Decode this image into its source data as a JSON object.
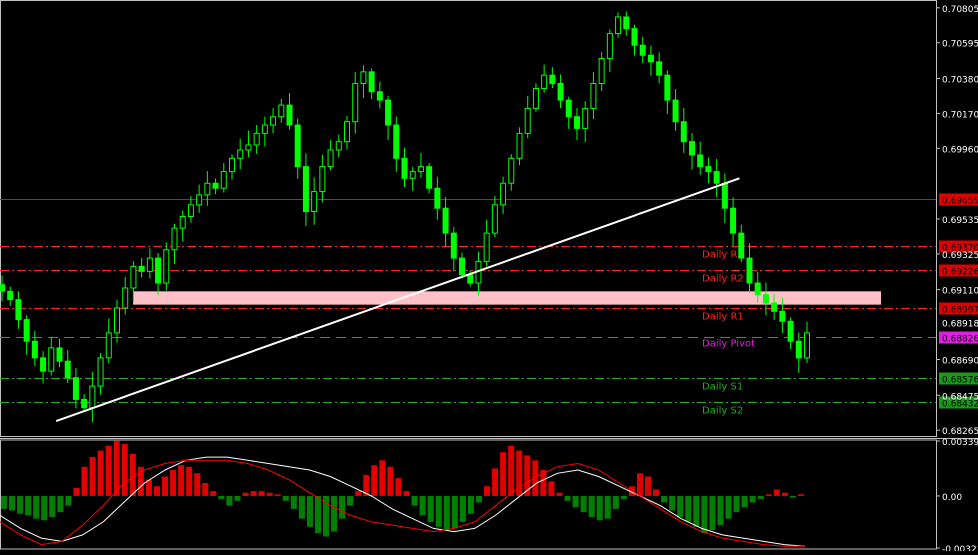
{
  "colors": {
    "background": "#000000",
    "frame": "#c0c0c0",
    "bull_candle": "#00ff00",
    "bear_candle": "#00ff00",
    "resistance": "#ff2020",
    "pivot": "#e020e0",
    "support": "#20b020",
    "horizontal_level": "#ff0000",
    "zone": "#ffc0c8",
    "trendline": "#ffffff",
    "hist_pos": "#e00000",
    "hist_neg": "#008000",
    "signal_white": "#ffffff",
    "signal_red": "#ff0000",
    "axis_text": "#ffffff"
  },
  "chart_data": [
    {
      "type": "candlestick",
      "panel": "price",
      "y_axis_ticks": [
        "0.70805",
        "0.70595",
        "0.70380",
        "0.70170",
        "0.69960",
        "0.69535",
        "0.69325",
        "0.69110",
        "0.68690",
        "0.68475",
        "0.68265"
      ],
      "ylim": [
        0.6823,
        0.7084
      ],
      "close_path": [
        0.691,
        0.6905,
        0.6893,
        0.688,
        0.687,
        0.6862,
        0.6876,
        0.6868,
        0.6858,
        0.6845,
        0.684,
        0.6853,
        0.687,
        0.6885,
        0.69,
        0.6912,
        0.6925,
        0.6922,
        0.693,
        0.6915,
        0.6935,
        0.6948,
        0.6955,
        0.6962,
        0.6968,
        0.6975,
        0.6972,
        0.6982,
        0.699,
        0.6995,
        0.6998,
        0.7005,
        0.701,
        0.7015,
        0.7022,
        0.701,
        0.6985,
        0.6958,
        0.697,
        0.6985,
        0.6995,
        0.7,
        0.7012,
        0.7035,
        0.7042,
        0.703,
        0.7025,
        0.701,
        0.699,
        0.6978,
        0.6982,
        0.6985,
        0.6972,
        0.696,
        0.6945,
        0.693,
        0.692,
        0.6915,
        0.6928,
        0.6945,
        0.6962,
        0.6975,
        0.699,
        0.7005,
        0.702,
        0.7032,
        0.704,
        0.7035,
        0.7025,
        0.7015,
        0.7008,
        0.702,
        0.7035,
        0.705,
        0.7065,
        0.7075,
        0.7068,
        0.7058,
        0.7052,
        0.7048,
        0.704,
        0.7025,
        0.7012,
        0.7,
        0.6992,
        0.6985,
        0.6982,
        0.6975,
        0.696,
        0.6945,
        0.693,
        0.6915,
        0.6908,
        0.6903,
        0.6898,
        0.6892,
        0.688,
        0.687,
        0.6885
      ],
      "levels": [
        {
          "label": "0.69655",
          "value": 0.69655,
          "style": "solid",
          "text": ""
        },
        {
          "label": "0.69370",
          "value": 0.6937,
          "style": "dashdot",
          "text": "Daily R3"
        },
        {
          "label": "0.69226",
          "value": 0.69226,
          "style": "dashdot",
          "text": "Daily R2"
        },
        {
          "label": "0.68997",
          "value": 0.68997,
          "style": "dashdot",
          "text": "Daily R1"
        },
        {
          "label": "0.68826",
          "value": 0.68826,
          "style": "dashed",
          "text": "Daily Pivot"
        },
        {
          "label": "0.68576",
          "value": 0.68576,
          "style": "dashdot",
          "text": "Daily S1"
        },
        {
          "label": "0.68432",
          "value": 0.68432,
          "style": "dashdot",
          "text": "Daily S2"
        }
      ],
      "current_price_label": "0.68918",
      "current_price": 0.68918,
      "zone": {
        "low": 0.6902,
        "high": 0.691
      },
      "trendline": {
        "from": [
          0.06,
          0.6832
        ],
        "to": [
          0.79,
          0.6978
        ]
      }
    },
    {
      "type": "histogram",
      "panel": "oscillator",
      "y_axis_ticks": [
        "0.00339",
        "0.00",
        "-0.00321"
      ],
      "ylim": [
        -0.00321,
        0.00339
      ],
      "values": [
        -0.0008,
        -0.0009,
        -0.0011,
        -0.0012,
        -0.0014,
        -0.0015,
        -0.0013,
        -0.001,
        -0.0006,
        0.0005,
        0.0018,
        0.0024,
        0.0028,
        0.0031,
        0.0034,
        0.0032,
        0.0026,
        0.0018,
        0.001,
        0.0006,
        0.0012,
        0.0016,
        0.0019,
        0.0018,
        0.0014,
        0.0008,
        0.0003,
        -0.0002,
        -0.0006,
        -0.0003,
        0.0002,
        0.0003,
        0.0003,
        0.0002,
        0.0001,
        -0.0003,
        -0.0008,
        -0.0014,
        -0.0019,
        -0.0023,
        -0.0025,
        -0.0022,
        -0.0014,
        -0.0006,
        0.0003,
        0.0013,
        0.0019,
        0.0022,
        0.0018,
        0.0011,
        0.0003,
        -0.0006,
        -0.0012,
        -0.0016,
        -0.0019,
        -0.0021,
        -0.002,
        -0.0016,
        -0.0011,
        -0.0004,
        0.0006,
        0.0017,
        0.0027,
        0.0031,
        0.0028,
        0.0025,
        0.0022,
        0.0016,
        0.0009,
        0.0002,
        -0.0003,
        -0.0007,
        -0.001,
        -0.0013,
        -0.0015,
        -0.0014,
        -0.0008,
        -0.0002,
        0.0006,
        0.0014,
        0.0012,
        0.0004,
        -0.0004,
        -0.0009,
        -0.0013,
        -0.0016,
        -0.0019,
        -0.0023,
        -0.0021,
        -0.0018,
        -0.0014,
        -0.001,
        -0.0007,
        -0.0004,
        -0.0002,
        0.0001,
        0.0004,
        0.0002,
        -0.0001,
        0.0001
      ],
      "signal_white": [
        -0.0012,
        -0.002,
        -0.0026,
        -0.0028,
        -0.0024,
        -0.0016,
        -0.0004,
        0.0008,
        0.0016,
        0.0022,
        0.0024,
        0.0024,
        0.0022,
        0.002,
        0.0018,
        0.0016,
        0.0012,
        0.0006,
        0.0,
        -0.0008,
        -0.0014,
        -0.002,
        -0.0022,
        -0.002,
        -0.0012,
        -0.0002,
        0.0008,
        0.0014,
        0.0016,
        0.0012,
        0.0006,
        0.0,
        -0.0006,
        -0.0014,
        -0.002,
        -0.0024,
        -0.0026,
        -0.0028,
        -0.003,
        -0.0031
      ],
      "signal_red": [
        -0.0016,
        -0.0024,
        -0.003,
        -0.0028,
        -0.0018,
        -0.0006,
        0.0008,
        0.0016,
        0.002,
        0.0022,
        0.0022,
        0.0022,
        0.002,
        0.0016,
        0.001,
        0.0002,
        -0.0006,
        -0.0012,
        -0.0016,
        -0.0018,
        -0.002,
        -0.0022,
        -0.002,
        -0.0016,
        -0.0006,
        0.0004,
        0.0012,
        0.0018,
        0.002,
        0.0016,
        0.0008,
        0.0,
        -0.0008,
        -0.0016,
        -0.0022,
        -0.0026,
        -0.0028,
        -0.003,
        -0.0031,
        -0.0031
      ]
    }
  ]
}
